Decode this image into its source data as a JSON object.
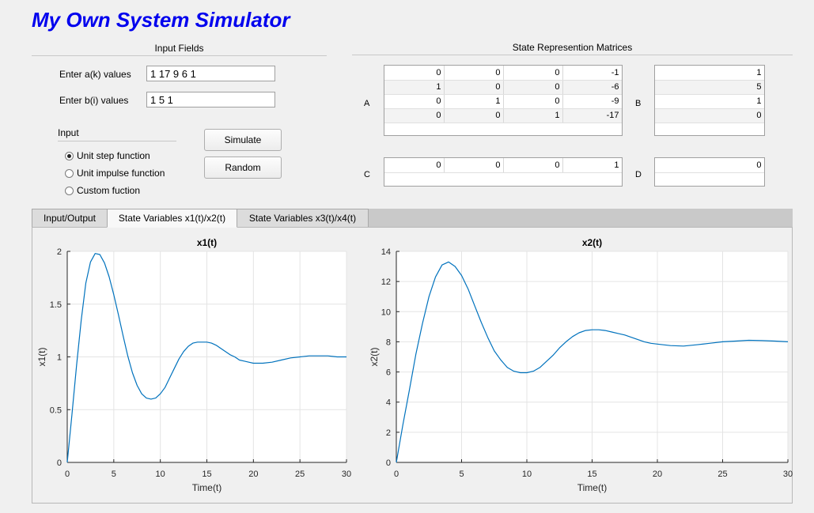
{
  "app": {
    "title": "My Own System Simulator"
  },
  "input_fields": {
    "title": "Input Fields",
    "a_label": "Enter a(k)  values",
    "a_value": "1 17 9 6 1",
    "b_label": "Enter b(i)  values",
    "b_value": "1 5 1"
  },
  "input_group": {
    "title": "Input",
    "options": [
      {
        "label": "Unit step function",
        "selected": true
      },
      {
        "label": "Unit impulse function",
        "selected": false
      },
      {
        "label": "Custom fuction",
        "selected": false
      }
    ]
  },
  "buttons": {
    "simulate": "Simulate",
    "random": "Random"
  },
  "matrices": {
    "title": "State Represention Matrices",
    "A": {
      "label": "A",
      "rows": [
        [
          "0",
          "0",
          "0",
          "-1"
        ],
        [
          "1",
          "0",
          "0",
          "-6"
        ],
        [
          "0",
          "1",
          "0",
          "-9"
        ],
        [
          "0",
          "0",
          "1",
          "-17"
        ]
      ]
    },
    "B": {
      "label": "B",
      "rows": [
        [
          "1"
        ],
        [
          "5"
        ],
        [
          "1"
        ],
        [
          "0"
        ]
      ]
    },
    "C": {
      "label": "C",
      "rows": [
        [
          "0",
          "0",
          "0",
          "1"
        ]
      ]
    },
    "D": {
      "label": "D",
      "rows": [
        [
          "0"
        ]
      ]
    }
  },
  "tabs": [
    {
      "label": "Input/Output",
      "active": false
    },
    {
      "label": "State Variables x1(t)/x2(t)",
      "active": true
    },
    {
      "label": "State Variables x3(t)/x4(t)",
      "active": false
    }
  ],
  "colors": {
    "title": "#0000ee",
    "line": "#0072bd"
  },
  "chart_data": [
    {
      "type": "line",
      "title": "x1(t)",
      "xlabel": "Time(t)",
      "ylabel": "x1(t)",
      "xlim": [
        0,
        30
      ],
      "ylim": [
        0,
        2
      ],
      "xticks": [
        0,
        5,
        10,
        15,
        20,
        25,
        30
      ],
      "yticks": [
        0,
        0.5,
        1,
        1.5,
        2
      ],
      "ytick_labels": [
        "0",
        "0.5",
        "1",
        "1.5",
        "2"
      ],
      "grid": true,
      "series": [
        {
          "x": [
            0,
            0.5,
            1,
            1.5,
            2,
            2.5,
            3,
            3.5,
            4,
            4.5,
            5,
            5.5,
            6,
            6.5,
            7,
            7.5,
            8,
            8.5,
            9,
            9.5,
            10,
            10.5,
            11,
            11.5,
            12,
            12.5,
            13,
            13.5,
            14,
            14.5,
            15,
            15.5,
            16,
            16.5,
            17,
            17.5,
            18,
            18.5,
            19,
            19.5,
            20,
            21,
            22,
            23,
            24,
            25,
            26,
            27,
            28,
            29,
            30
          ],
          "y": [
            0,
            0.45,
            0.92,
            1.35,
            1.7,
            1.9,
            1.98,
            1.97,
            1.89,
            1.76,
            1.59,
            1.4,
            1.2,
            1.01,
            0.85,
            0.73,
            0.65,
            0.61,
            0.6,
            0.61,
            0.65,
            0.71,
            0.8,
            0.89,
            0.98,
            1.05,
            1.1,
            1.13,
            1.14,
            1.14,
            1.14,
            1.13,
            1.11,
            1.08,
            1.05,
            1.02,
            1.0,
            0.97,
            0.96,
            0.95,
            0.94,
            0.94,
            0.95,
            0.97,
            0.99,
            1.0,
            1.01,
            1.01,
            1.01,
            1.0,
            1.0
          ]
        }
      ]
    },
    {
      "type": "line",
      "title": "x2(t)",
      "xlabel": "Time(t)",
      "ylabel": "x2(t)",
      "xlim": [
        0,
        30
      ],
      "ylim": [
        0,
        14
      ],
      "xticks": [
        0,
        5,
        10,
        15,
        20,
        25,
        30
      ],
      "yticks": [
        0,
        2,
        4,
        6,
        8,
        10,
        12,
        14
      ],
      "ytick_labels": [
        "0",
        "2",
        "4",
        "6",
        "8",
        "10",
        "12",
        "14"
      ],
      "grid": true,
      "series": [
        {
          "x": [
            0,
            0.5,
            1,
            1.5,
            2,
            2.5,
            3,
            3.5,
            4,
            4.5,
            5,
            5.5,
            6,
            6.5,
            7,
            7.5,
            8,
            8.5,
            9,
            9.5,
            10,
            10.5,
            11,
            11.5,
            12,
            12.5,
            13,
            13.5,
            14,
            14.5,
            15,
            15.5,
            16,
            16.5,
            17,
            17.5,
            18,
            18.5,
            19,
            19.5,
            20,
            21,
            22,
            23,
            24,
            25,
            26,
            27,
            28,
            29,
            30
          ],
          "y": [
            0,
            2.5,
            4.8,
            7.2,
            9.2,
            11,
            12.3,
            13.1,
            13.3,
            13.0,
            12.4,
            11.5,
            10.4,
            9.3,
            8.3,
            7.4,
            6.8,
            6.3,
            6.05,
            5.95,
            5.95,
            6.05,
            6.3,
            6.7,
            7.1,
            7.6,
            8.0,
            8.35,
            8.6,
            8.75,
            8.8,
            8.8,
            8.75,
            8.65,
            8.55,
            8.45,
            8.3,
            8.15,
            8.0,
            7.9,
            7.85,
            7.75,
            7.72,
            7.8,
            7.9,
            8.0,
            8.05,
            8.1,
            8.08,
            8.05,
            8.0
          ]
        }
      ]
    }
  ]
}
